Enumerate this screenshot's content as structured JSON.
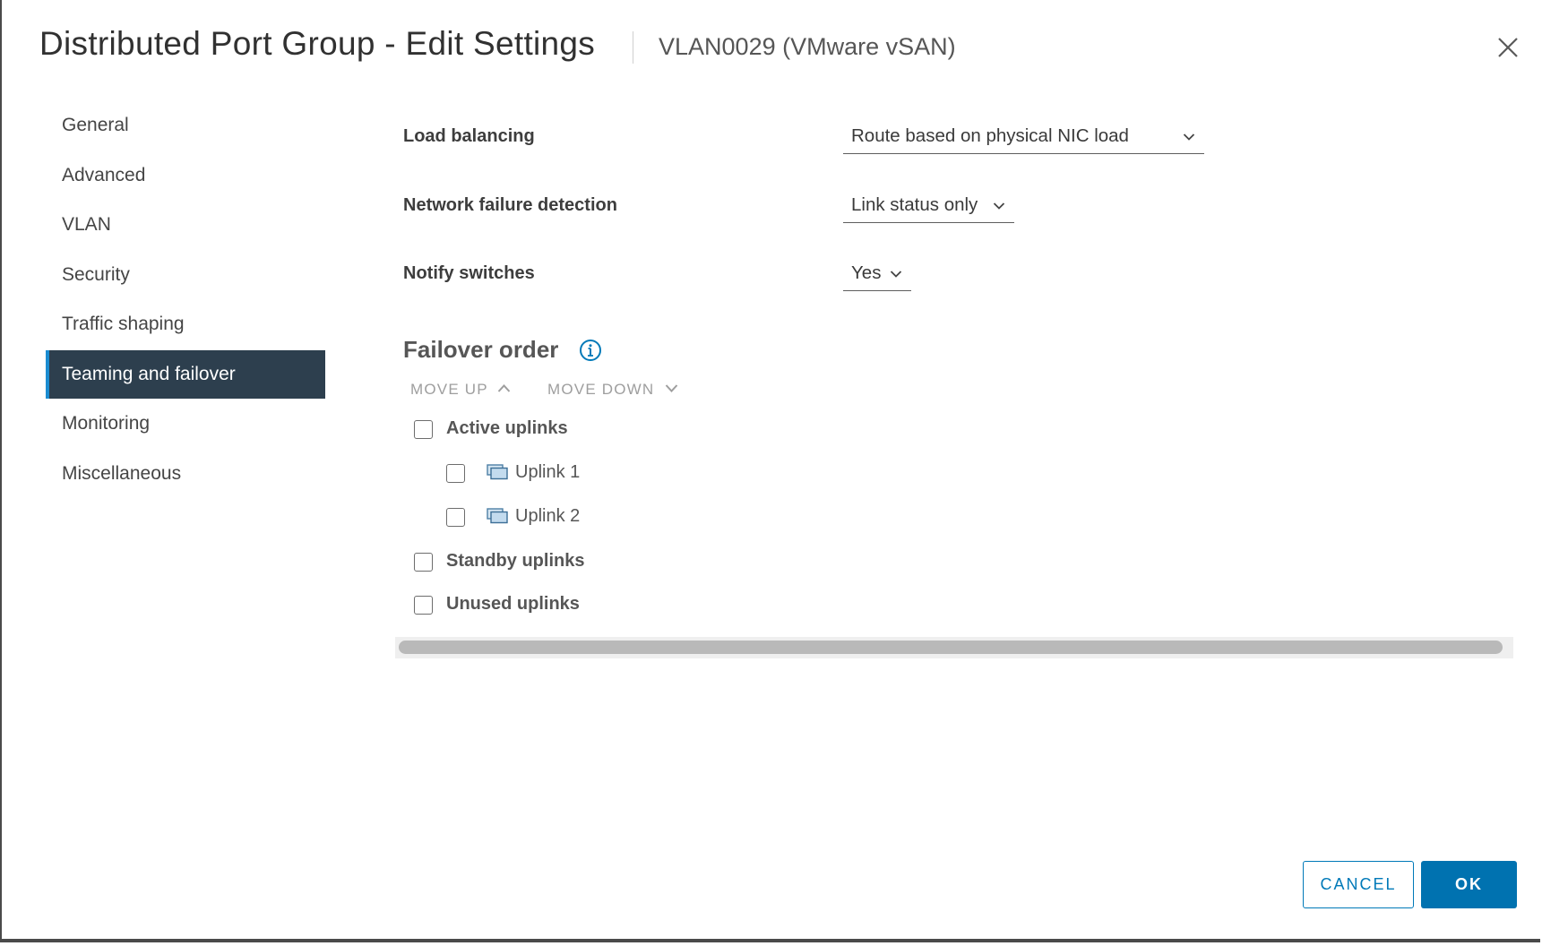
{
  "header": {
    "title": "Distributed Port Group - Edit Settings",
    "subtitle": "VLAN0029 (VMware vSAN)"
  },
  "nav": {
    "items": [
      {
        "label": "General"
      },
      {
        "label": "Advanced"
      },
      {
        "label": "VLAN"
      },
      {
        "label": "Security"
      },
      {
        "label": "Traffic shaping"
      },
      {
        "label": "Teaming and failover"
      },
      {
        "label": "Monitoring"
      },
      {
        "label": "Miscellaneous"
      }
    ],
    "active": "Teaming and failover"
  },
  "form": {
    "load_balancing": {
      "label": "Load balancing",
      "value": "Route based on physical NIC load"
    },
    "network_failure_detection": {
      "label": "Network failure detection",
      "value": "Link status only"
    },
    "notify_switches": {
      "label": "Notify switches",
      "value": "Yes"
    }
  },
  "failover": {
    "title": "Failover order",
    "move_up": "MOVE UP",
    "move_down": "MOVE DOWN",
    "active_uplinks": "Active uplinks",
    "uplinks": [
      "Uplink 1",
      "Uplink 2"
    ],
    "standby_uplinks": "Standby uplinks",
    "unused_uplinks": "Unused uplinks"
  },
  "footer": {
    "cancel": "CANCEL",
    "ok": "OK"
  },
  "colors": {
    "accent": "#0079b8",
    "nav_active_bg": "#2d3f4e",
    "nav_active_bar": "#1b8cd1",
    "ok_bg": "#0072b0"
  },
  "icons": [
    "close-icon",
    "chevron-down-icon",
    "info-icon",
    "chevron-up-icon",
    "uplink-icon"
  ]
}
